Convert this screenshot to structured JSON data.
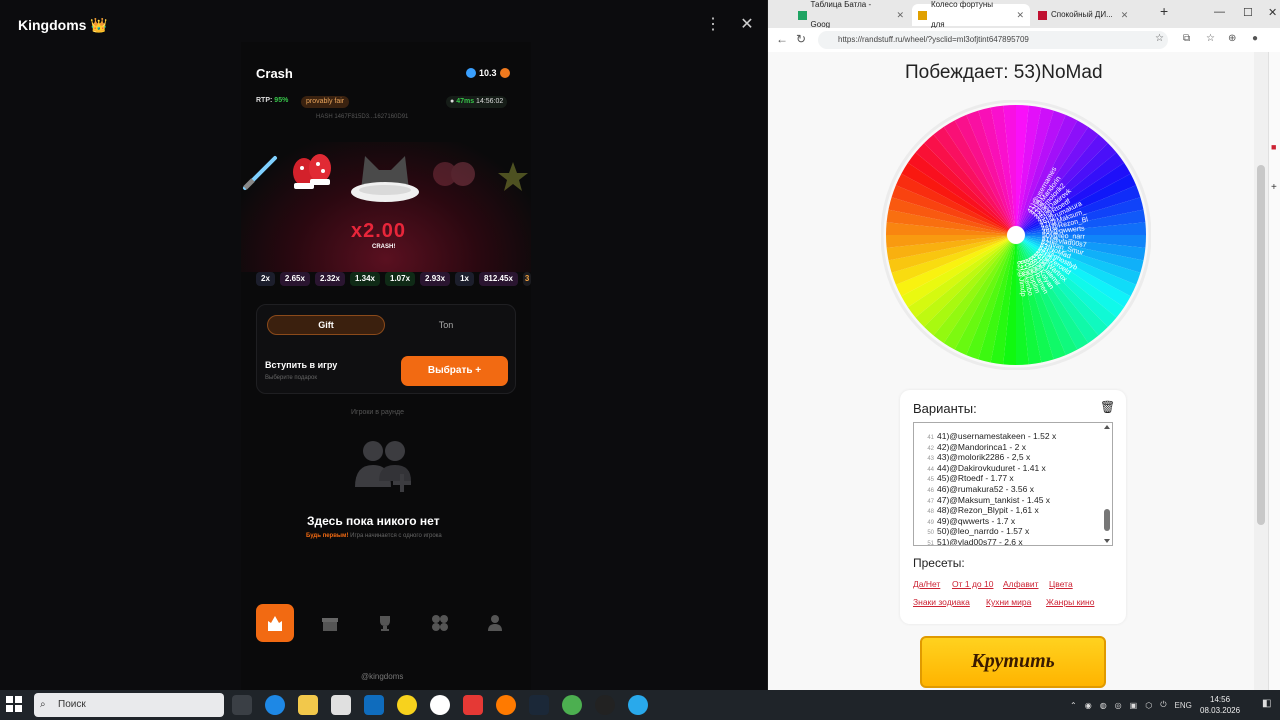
{
  "telegram": {
    "title": "Kingdoms 👑",
    "menu_icon": "⋮",
    "close_icon": "✕"
  },
  "app": {
    "title": "Crash",
    "balance": "10.3",
    "rtp_label": "RTP:",
    "rtp_value": "95%",
    "provably_fair": "provably fair",
    "ping": "47ms",
    "time": "14:56:02",
    "hash": "HASH   1467F815D3...1627160D91",
    "multiplier": "x2.00",
    "crash_label": "CRASH!",
    "history": [
      "2x",
      "2.65x",
      "2.32x",
      "1.34x",
      "1.07x",
      "2.93x",
      "1x",
      "812.45x",
      "3"
    ],
    "tabs": {
      "gift": "Gift",
      "ton": "Ton"
    },
    "join_title": "Вступить в игру",
    "join_sub": "Выберите подарок",
    "pick_button": "Выбрать  +",
    "round_label": "Игроки в раунде",
    "empty_title": "Здесь пока никого нет",
    "empty_sub_em": "Будь первым!",
    "empty_sub": " Игра начинается с одного игрока",
    "footer": "@kingdoms"
  },
  "browser": {
    "tabs": [
      "Таблица Батла - Goog",
      "Колесо фортуны для",
      "Спокойный ДИ..."
    ],
    "url": "https://randstuff.ru/wheel/?ysclid=ml3ofjtint647895709",
    "winner": "Побеждает: 53)NoMad",
    "variants_title": "Варианты:",
    "variants": [
      {
        "n": "41",
        "t": "41)@usernamestakeen - 1.52 x"
      },
      {
        "n": "42",
        "t": "42)@Mandorinca1 - 2 x"
      },
      {
        "n": "43",
        "t": "43)@molorik2286 - 2,5 x"
      },
      {
        "n": "44",
        "t": "44)@Dakirovkuduret - 1.41 x"
      },
      {
        "n": "45",
        "t": "45)@Rtoedf - 1.77 x"
      },
      {
        "n": "46",
        "t": "46)@rumakura52 - 3.56 x"
      },
      {
        "n": "47",
        "t": "47)@Maksum_tankist - 1.45 x"
      },
      {
        "n": "48",
        "t": "48)@Rezon_Blypit - 1,61 x"
      },
      {
        "n": "49",
        "t": "49)@qwwerts - 1.7 x"
      },
      {
        "n": "50",
        "t": "50)@leo_narrdo - 1.57 x"
      },
      {
        "n": "51",
        "t": "51)@vlad00s77 - 2,6 x"
      }
    ],
    "presets_title": "Пресеты:",
    "presets": [
      "Да/Нет",
      "От 1 до 10",
      "Алфавит",
      "Цвета",
      "Знаки зодиака",
      "Кухни мира",
      "Жанры кино"
    ],
    "spin_button": "Крутить",
    "wheel_labels": [
      "41)@usernames",
      "42)@Mandorin",
      "43)@molorik2",
      "44)@Dakirovk",
      "45)@Rtoedf",
      "46)@rumakura",
      "47)@Maksum_",
      "48)@Rezon_Bl",
      "49)@qwwerts",
      "50)@leo_narr",
      "51)@vlad00s7",
      "52)Ivan_Smur",
      "53)NoMad",
      "54)@ghostlyb",
      "55)@zeroeld",
      "56)@Wartrox",
      "57)@Jalemir",
      "58)@Kolyan",
      "59)@Ramen",
      "60)@toplim",
      "61)@kenbo",
      "62)@Jlmdp"
    ]
  },
  "taskbar": {
    "search": "Поиск",
    "lang": "ENG",
    "time": "14:56",
    "date": "08.03.2026"
  }
}
